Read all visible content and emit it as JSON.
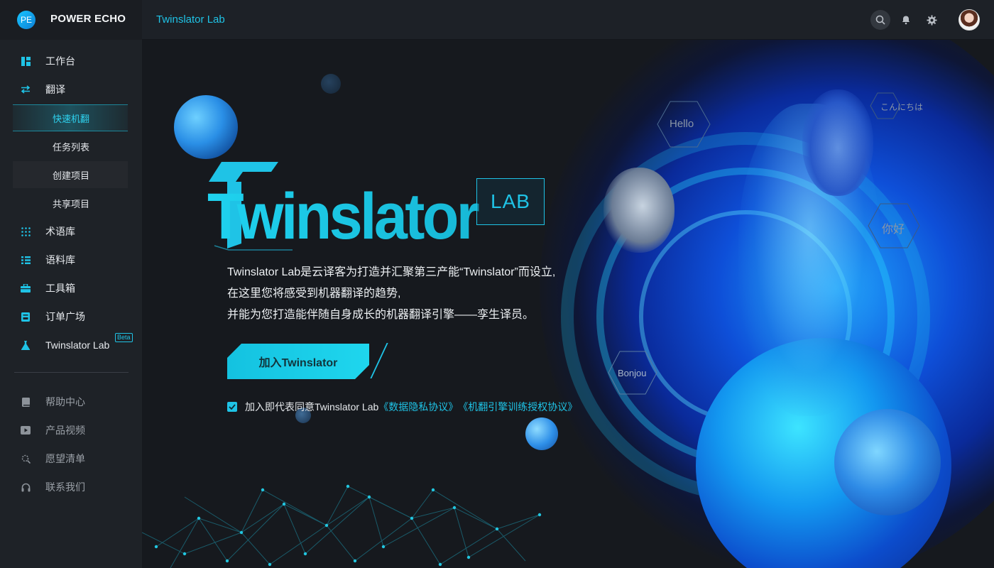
{
  "brand": {
    "logo_text": "PE",
    "name": "POWER ECHO"
  },
  "topbar": {
    "title": "Twinslator Lab",
    "icons": [
      "search-icon",
      "bell-icon",
      "gear-icon",
      "avatar"
    ]
  },
  "sidebar": {
    "items": [
      {
        "label": "工作台",
        "icon": "dashboard-icon"
      },
      {
        "label": "翻译",
        "icon": "swap-icon"
      },
      {
        "label": "术语库",
        "icon": "grid-dots-icon"
      },
      {
        "label": "语料库",
        "icon": "list-icon"
      },
      {
        "label": "工具箱",
        "icon": "toolbox-icon"
      },
      {
        "label": "订单广场",
        "icon": "order-icon"
      },
      {
        "label": "Twinslator Lab",
        "icon": "flask-icon",
        "badge": "Beta"
      }
    ],
    "sub_items": [
      {
        "label": "快速机翻",
        "active": true
      },
      {
        "label": "任务列表"
      },
      {
        "label": "创建项目"
      },
      {
        "label": "共享项目"
      }
    ],
    "footer_items": [
      {
        "label": "帮助中心",
        "icon": "book-icon"
      },
      {
        "label": "产品视频",
        "icon": "play-icon"
      },
      {
        "label": "愿望清单",
        "icon": "wish-icon"
      },
      {
        "label": "联系我们",
        "icon": "headset-icon"
      }
    ]
  },
  "hero": {
    "wordmark": "Twinslator",
    "lab_badge": "LAB",
    "description": [
      "Twinslator Lab是云译客为打造并汇聚第三产能“Twinslator”而设立,",
      "在这里您将感受到机器翻译的趋势,",
      "并能为您打造能伴随自身成长的机器翻译引擎——孪生译员。"
    ],
    "join_button": "加入Twinslator",
    "agreement": {
      "checked": true,
      "prefix": "加入即代表同意Twinslator Lab",
      "link1": "《数据隐私协议》",
      "link2": "《机翻引擎训练授权协议》"
    },
    "greetings": [
      "Hello",
      "こんにちは",
      "你好",
      "Bonjou"
    ]
  },
  "colors": {
    "accent": "#1fc3e6",
    "sidebar_bg": "#1e2227",
    "main_bg": "#16191e"
  }
}
